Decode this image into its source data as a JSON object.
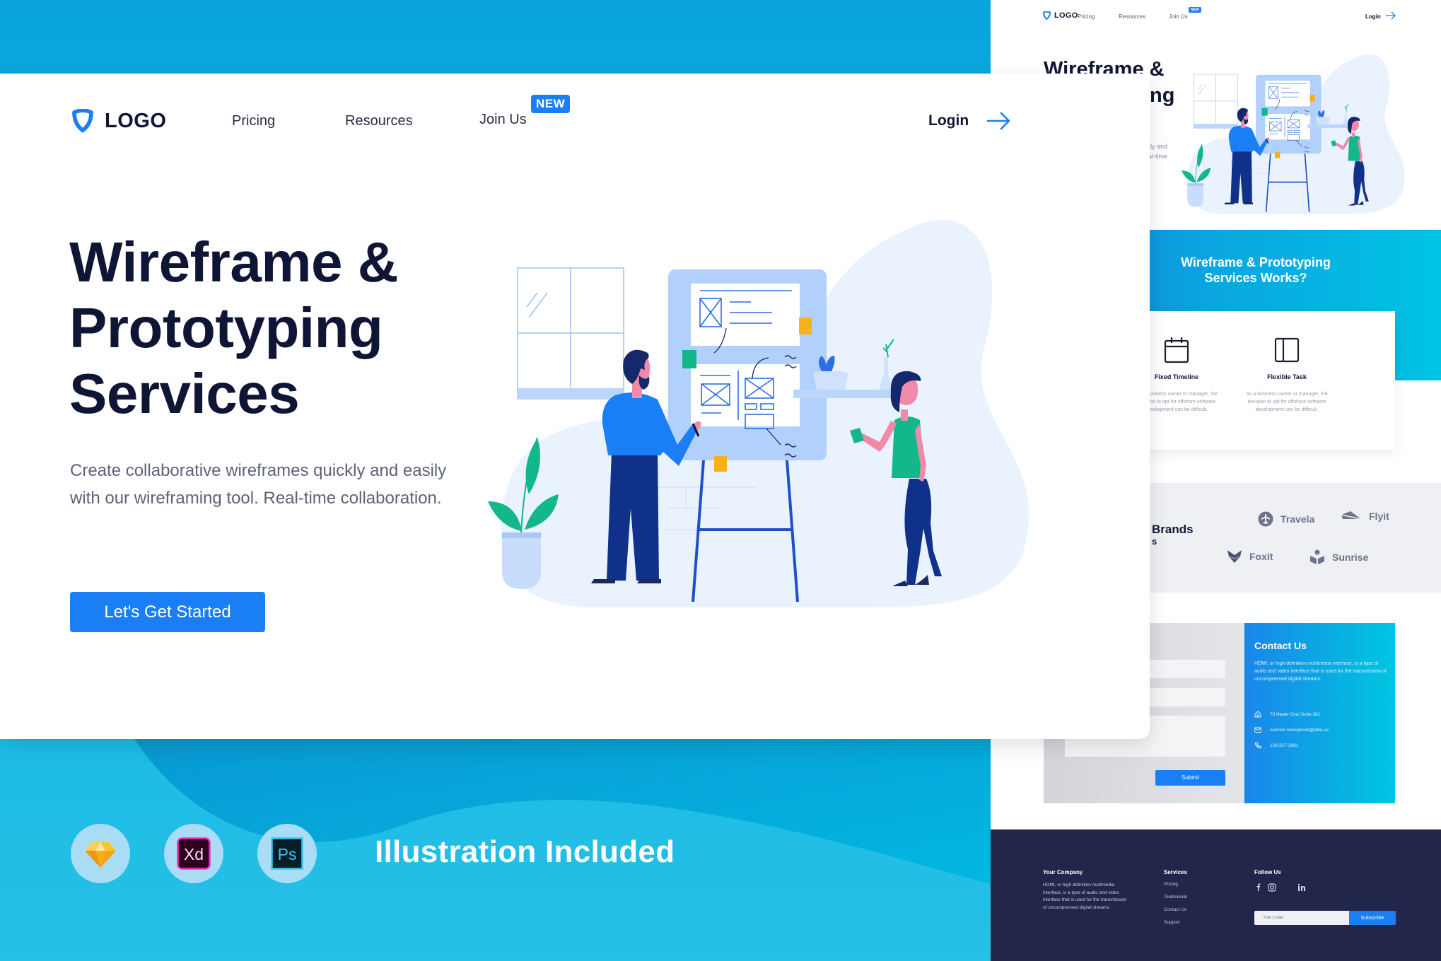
{
  "colors": {
    "accent": "#1a7ff5",
    "navy": "#0f1535",
    "footer_bg": "#22264a",
    "blue_band": "#0aa3dc",
    "illustration_green": "#13b88a",
    "sticky_yellow": "#f7b21b",
    "skin_pink": "#f08aa8"
  },
  "main": {
    "nav": {
      "logo_text": "LOGO",
      "links": [
        {
          "label": "Pricing"
        },
        {
          "label": "Resources"
        },
        {
          "label": "Join Us",
          "badge": "NEW"
        }
      ],
      "login_label": "Login"
    },
    "hero": {
      "title_lines": [
        "Wireframe &",
        "Prototyping",
        "Services"
      ],
      "description": "Create collaborative wireframes quickly and easily with our wireframing tool. Real-time collaboration.",
      "cta_label": "Let's Get Started"
    }
  },
  "tools": {
    "icons": [
      {
        "name": "Sketch",
        "icon": "sketch-icon"
      },
      {
        "name": "Adobe XD",
        "icon": "xd-icon",
        "glyph": "Xd"
      },
      {
        "name": "Photoshop",
        "icon": "ps-icon",
        "glyph": "Ps"
      }
    ],
    "title": "Illustration Included"
  },
  "preview": {
    "nav": {
      "logo_text": "LOGO",
      "links": [
        "Pricing",
        "Resources",
        "Join Us"
      ],
      "badge": "NEW",
      "login_label": "Login"
    },
    "hero": {
      "title_lines": [
        "Wireframe &",
        "ng"
      ],
      "text_lines": [
        "uickly and",
        "Real-time"
      ]
    },
    "services": {
      "title_line1": "Wireframe &  Prototyping",
      "title_line2": "Services Works?",
      "cards": [
        {
          "icon": "calendar-icon",
          "title": "Fixed Timeline",
          "text": "As a business owner or manager, the decision to opt for offshore software development can be difficult."
        },
        {
          "icon": "layout-icon",
          "title": "Flexible Task",
          "text": "As a business owner or manager, the decision to opt for offshore software development can be difficult."
        }
      ]
    },
    "brands": {
      "title_line1": "Brands",
      "title_line2": "s",
      "items": [
        {
          "name": "Travela",
          "icon": "plane-icon"
        },
        {
          "name": "Flyit",
          "icon": "paper-plane-icon"
        },
        {
          "name": "Foxit",
          "icon": "fox-icon"
        },
        {
          "name": "Sunrise",
          "icon": "sunrise-icon"
        }
      ]
    },
    "contact": {
      "submit_label": "Submit",
      "title": "Contact Us",
      "text": "HDMI, or high definition multimedia interface, is a type of audio and video interface that is used for the transmission of uncompressed digital streams.",
      "address": "73 Nader Oval Suite 381",
      "email": "camren.macejkovic@alba.us",
      "phone": "128-327-2661"
    },
    "footer": {
      "company_title": "Your Company",
      "company_text": "HDMI, or high definition multimedia interface, is a type of audio and video interface that is used for the transmission of uncompressed digital streams.",
      "services_title": "Services",
      "services_links": [
        "Pricing",
        "Testimonial",
        "Contact Us",
        "Support"
      ],
      "follow_title": "Follow Us",
      "email_placeholder": "Your Email",
      "subscribe_label": "Subscribe"
    }
  }
}
